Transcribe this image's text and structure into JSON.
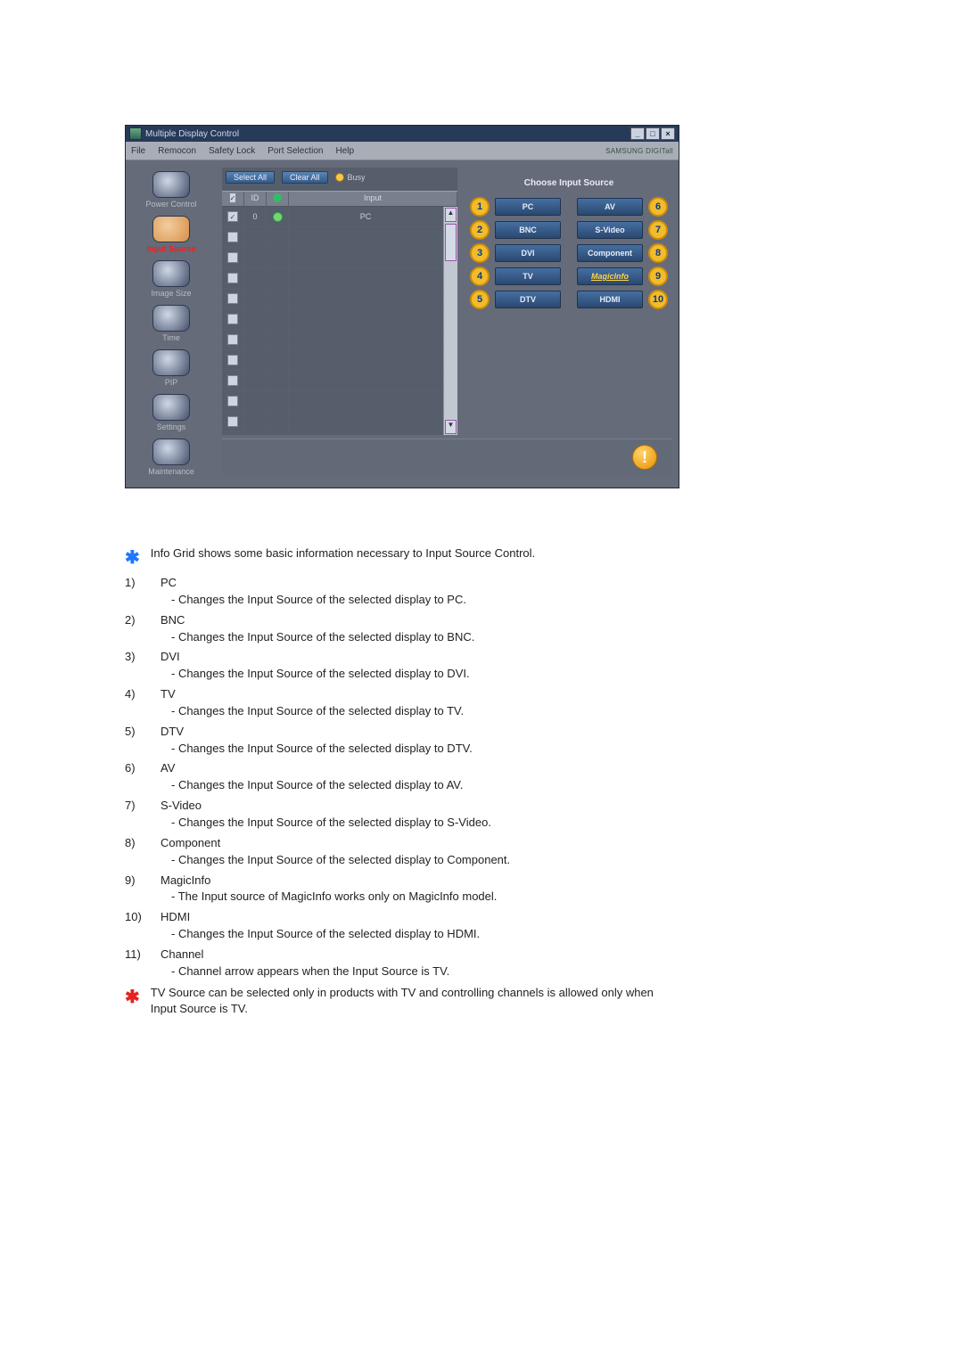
{
  "window": {
    "title": "Multiple Display Control",
    "brand": "SAMSUNG DIGITall",
    "menubar": [
      "File",
      "Remocon",
      "Safety Lock",
      "Port Selection",
      "Help"
    ],
    "win_min": "_",
    "win_max": "□",
    "win_close": "×"
  },
  "sidebar": {
    "items": [
      {
        "label": "Power Control"
      },
      {
        "label": "Input Source"
      },
      {
        "label": "Image Size"
      },
      {
        "label": "Time"
      },
      {
        "label": "PIP"
      },
      {
        "label": "Settings"
      },
      {
        "label": "Maintenance"
      }
    ]
  },
  "gridbar": {
    "select_all": "Select All",
    "clear_all": "Clear All",
    "busy": "Busy"
  },
  "gridhdr": {
    "chk": "",
    "id": "ID",
    "dot": "",
    "input": "Input"
  },
  "gridrows": [
    {
      "checked": true,
      "id": "0",
      "green": true,
      "input": "PC"
    },
    {
      "checked": false,
      "id": "",
      "green": false,
      "input": ""
    },
    {
      "checked": false,
      "id": "",
      "green": false,
      "input": ""
    },
    {
      "checked": false,
      "id": "",
      "green": false,
      "input": ""
    },
    {
      "checked": false,
      "id": "",
      "green": false,
      "input": ""
    },
    {
      "checked": false,
      "id": "",
      "green": false,
      "input": ""
    },
    {
      "checked": false,
      "id": "",
      "green": false,
      "input": ""
    },
    {
      "checked": false,
      "id": "",
      "green": false,
      "input": ""
    },
    {
      "checked": false,
      "id": "",
      "green": false,
      "input": ""
    },
    {
      "checked": false,
      "id": "",
      "green": false,
      "input": ""
    },
    {
      "checked": false,
      "id": "",
      "green": false,
      "input": ""
    }
  ],
  "panel": {
    "title": "Choose Input Source",
    "left": [
      {
        "n": "1",
        "label": "PC"
      },
      {
        "n": "2",
        "label": "BNC"
      },
      {
        "n": "3",
        "label": "DVI"
      },
      {
        "n": "4",
        "label": "TV"
      },
      {
        "n": "5",
        "label": "DTV"
      }
    ],
    "right": [
      {
        "n": "6",
        "label": "AV"
      },
      {
        "n": "7",
        "label": "S-Video"
      },
      {
        "n": "8",
        "label": "Component"
      },
      {
        "n": "9",
        "label": "MagicInfo",
        "magic": true
      },
      {
        "n": "10",
        "label": "HDMI"
      }
    ]
  },
  "help_mark": "!",
  "intro": "Info Grid shows some basic information necessary to Input Source Control.",
  "doc": [
    {
      "n": "1)",
      "label": "PC",
      "desc": "- Changes the Input Source of the selected display to PC."
    },
    {
      "n": "2)",
      "label": "BNC",
      "desc": "- Changes the Input Source of the selected display to BNC."
    },
    {
      "n": "3)",
      "label": "DVI",
      "desc": "- Changes the Input Source of the selected display to DVI."
    },
    {
      "n": "4)",
      "label": "TV",
      "desc": "- Changes the Input Source of the selected display to TV."
    },
    {
      "n": "5)",
      "label": "DTV",
      "desc": "- Changes the Input Source of the selected display to DTV."
    },
    {
      "n": "6)",
      "label": "AV",
      "desc": "- Changes the Input Source of the selected display to AV."
    },
    {
      "n": "7)",
      "label": "S-Video",
      "desc": "- Changes the Input Source of the selected display to S-Video."
    },
    {
      "n": "8)",
      "label": "Component",
      "desc": "- Changes the Input Source of the selected display to Component."
    },
    {
      "n": "9)",
      "label": "MagicInfo",
      "desc": "- The Input source of MagicInfo works only on MagicInfo model."
    },
    {
      "n": "10)",
      "label": "HDMI",
      "desc": "- Changes the Input Source of the selected display to HDMI."
    },
    {
      "n": "11)",
      "label": "Channel",
      "desc": "- Channel arrow appears when the Input Source is TV."
    }
  ],
  "note": "TV Source can be selected only in products with TV and controlling channels is allowed only when Input Source is TV.",
  "star": "✱"
}
